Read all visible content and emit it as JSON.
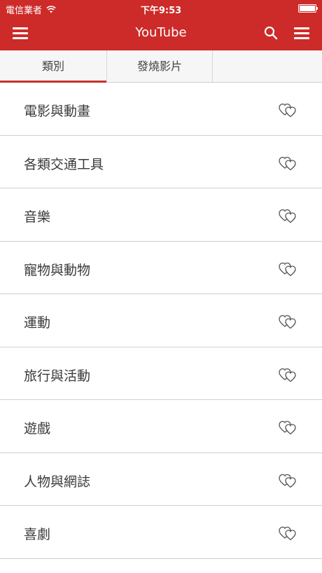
{
  "status_bar": {
    "carrier": "電信業者",
    "time": "下午9:53"
  },
  "navbar": {
    "title": "YouTube"
  },
  "tabs": [
    {
      "label": "類別",
      "active": true
    },
    {
      "label": "發燒影片",
      "active": false
    }
  ],
  "categories": [
    {
      "label": "電影與動畫"
    },
    {
      "label": "各類交通工具"
    },
    {
      "label": "音樂"
    },
    {
      "label": "寵物與動物"
    },
    {
      "label": "運動"
    },
    {
      "label": "旅行與活動"
    },
    {
      "label": "遊戲"
    },
    {
      "label": "人物與網誌"
    },
    {
      "label": "喜劇"
    }
  ],
  "icons": {
    "menu": "hamburger-menu-icon",
    "search": "search-icon",
    "favorite": "double-heart-outline-icon",
    "wifi": "wifi-icon",
    "battery": "battery-icon"
  },
  "colors": {
    "header_red": "#cc2b29",
    "tab_indicator": "#c9302c"
  }
}
